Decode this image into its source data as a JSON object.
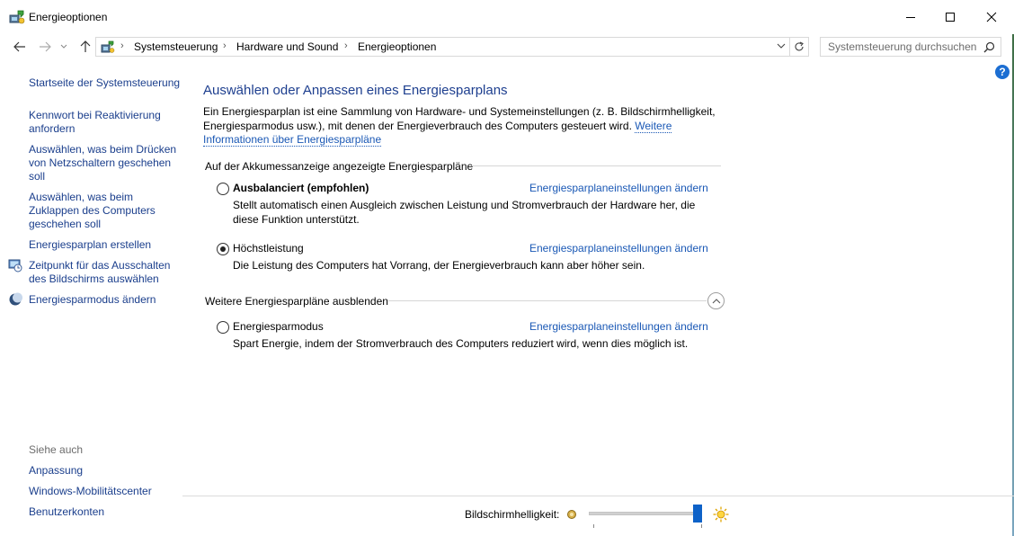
{
  "window": {
    "title": "Energieoptionen"
  },
  "address": {
    "crumbs": [
      "Systemsteuerung",
      "Hardware und Sound",
      "Energieoptionen"
    ],
    "search_placeholder": "Systemsteuerung durchsuchen"
  },
  "sidebar": {
    "home": "Startseite der Systemsteuerung",
    "items": [
      {
        "lines": [
          "Kennwort bei Reaktivierung",
          "anfordern"
        ]
      },
      {
        "lines": [
          "Auswählen, was beim Drücken",
          "von Netzschaltern geschehen",
          "soll"
        ]
      },
      {
        "lines": [
          "Auswählen, was beim",
          "Zuklappen des Computers",
          "geschehen soll"
        ]
      },
      {
        "lines": [
          "Energiesparplan erstellen"
        ]
      },
      {
        "lines": [
          "Zeitpunkt für das Ausschalten",
          "des Bildschirms auswählen"
        ],
        "icon": "clock-monitor-icon"
      },
      {
        "lines": [
          "Energiesparmodus ändern"
        ],
        "icon": "moon-icon"
      }
    ],
    "see_also": "Siehe auch",
    "see_also_items": [
      "Anpassung",
      "Windows-Mobilitätscenter",
      "Benutzerkonten"
    ]
  },
  "main": {
    "title": "Auswählen oder Anpassen eines Energiesparplans",
    "intro": "Ein Energiesparplan ist eine Sammlung von Hardware- und Systemeinstellungen (z. B. Bildschirmhelligkeit, Energiesparmodus usw.), mit denen der Energieverbrauch des Computers gesteuert wird.",
    "intro_link": "Weitere Informationen über Energiesparpläne",
    "group1_title": "Auf der Akkumessanzeige angezeigte Energiesparpläne",
    "group2_title": "Weitere Energiesparpläne ausblenden",
    "plans": [
      {
        "name": "Ausbalanciert (empfohlen)",
        "selected": false,
        "link": "Energiesparplaneinstellungen ändern",
        "desc": "Stellt automatisch einen Ausgleich zwischen Leistung und Stromverbrauch der Hardware her, die diese Funktion unterstützt."
      },
      {
        "name": "Höchstleistung",
        "selected": true,
        "link": "Energiesparplaneinstellungen ändern",
        "desc": "Die Leistung des Computers hat Vorrang, der Energieverbrauch kann aber höher sein."
      },
      {
        "name": "Energiesparmodus",
        "selected": false,
        "link": "Energiesparplaneinstellungen ändern",
        "desc": "Spart Energie, indem der Stromverbrauch des Computers reduziert wird, wenn dies möglich ist."
      }
    ]
  },
  "brightness": {
    "label": "Bildschirmhelligkeit:",
    "level": 1.0
  },
  "colors": {
    "link": "#1a58b5",
    "title": "#1e3f8f",
    "accent": "#0e62c8"
  }
}
